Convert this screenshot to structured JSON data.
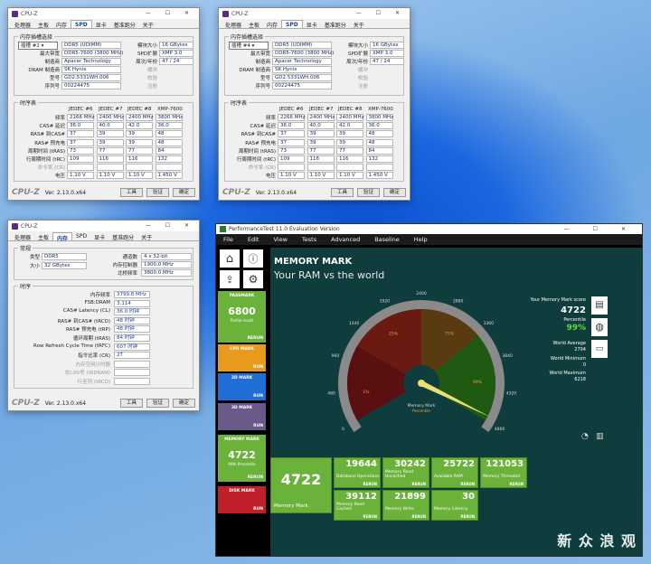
{
  "cpuz1": {
    "title": "CPU-Z",
    "tabs": [
      "处理器",
      "主板",
      "内存",
      "SPD",
      "显卡",
      "基准跑分",
      "关于"
    ],
    "group1": "内存插槽选择",
    "slot": "插槽 #2",
    "type": "DDR5 (UDIMM)",
    "size_label": "模块大小",
    "size": "16 GBytes",
    "maxbw_label": "最大带宽",
    "maxbw": "DDR5-7600 (3800 MHz)",
    "spd_label": "SPD扩展",
    "spd": "XMP 3.0",
    "maker_label": "制造商",
    "maker": "Apacer Technology",
    "week_label": "周次/年份",
    "week": "47 / 24",
    "dram_label": "DRAM 制造商",
    "dram": "SK Hynix",
    "reg_label": "缓冲",
    "part_label": "型号",
    "part": "GD2.5331WH.006",
    "ecc_label": "校验",
    "serial_label": "序列号",
    "serial": "00224475",
    "reg2_label": "注册",
    "timing_group": "时序表",
    "cols": [
      "JEDEC #6",
      "JEDEC #7",
      "JEDEC #8",
      "XMP-7600"
    ],
    "rows": [
      {
        "l": "频率",
        "v": [
          "2266 MHz",
          "2400 MHz",
          "2400 MHz",
          "3800 MHz"
        ]
      },
      {
        "l": "CAS# 延迟",
        "v": [
          "36.0",
          "40.0",
          "42.0",
          "36.0"
        ]
      },
      {
        "l": "RAS# 到CAS#",
        "v": [
          "37",
          "39",
          "39",
          "48"
        ]
      },
      {
        "l": "RAS# 预充电",
        "v": [
          "37",
          "39",
          "39",
          "48"
        ]
      },
      {
        "l": "周期时间 (tRAS)",
        "v": [
          "73",
          "77",
          "77",
          "84"
        ]
      },
      {
        "l": "行周期时间 (tRC)",
        "v": [
          "109",
          "116",
          "116",
          "132"
        ]
      },
      {
        "l": "命令率 (CR)",
        "v": [
          "",
          "",
          "",
          ""
        ]
      },
      {
        "l": "电压",
        "v": [
          "1.10 V",
          "1.10 V",
          "1.10 V",
          "1.450 V"
        ]
      }
    ],
    "ver": "Ver. 2.13.0.x64",
    "tools": "工具",
    "validate": "验证",
    "ok": "确定"
  },
  "cpuz2": {
    "slot": "插槽 #4"
  },
  "cpuz3": {
    "title": "CPU-Z",
    "tabs": [
      "处理器",
      "主板",
      "内存",
      "SPD",
      "显卡",
      "基准跑分",
      "关于"
    ],
    "g1": "常规",
    "type_l": "类型",
    "type": "DDR5",
    "size_l": "大小",
    "size": "32 GBytes",
    "ch_l": "通道数",
    "ch": "4 x 32-bit",
    "ctrl_l": "内存控制器",
    "ctrl": "1900.0 MHz",
    "nb_l": "北桥频率",
    "nb": "3800.0 MHz",
    "g2": "时序",
    "rows": [
      {
        "l": "内存频率",
        "v": "3799.8 MHz"
      },
      {
        "l": "FSB:DRAM",
        "v": "3:114"
      },
      {
        "l": "CAS# Latency (CL)",
        "v": "36.0 时钟"
      },
      {
        "l": "RAS# 到CAS# (tRCD)",
        "v": "48 时钟"
      },
      {
        "l": "RAS# 预充电 (tRP)",
        "v": "48 时钟"
      },
      {
        "l": "循环周期 (tRAS)",
        "v": "84 时钟"
      },
      {
        "l": "Row Refresh Cycle Time (tRFC)",
        "v": "607 时钟"
      },
      {
        "l": "指令比率 (CR)",
        "v": "2T"
      },
      {
        "l": "内存空闲计时器",
        "v": ""
      },
      {
        "l": "总CAS号 (tRDRAM)",
        "v": ""
      },
      {
        "l": "行至列 (tRCD)",
        "v": ""
      }
    ]
  },
  "pt": {
    "title": "PerformanceTest 11.0 Evaluation Version",
    "menu": [
      "File",
      "Edit",
      "View",
      "Tests",
      "Advanced",
      "Baseline",
      "Help"
    ],
    "heading": "MEMORY MARK",
    "subheading": "Your RAM vs the world",
    "score_label": "Your Memory Mark score",
    "score": "4722",
    "pct_label": "Percentile",
    "pct": "99%",
    "avg_label": "World Average",
    "avg": "2704",
    "min_label": "World Minimum",
    "min": "0",
    "max_label": "World Maximum",
    "max": "6218",
    "gauge_ticks": [
      "0",
      "480",
      "960",
      "1440",
      "1920",
      "2400",
      "2880",
      "3360",
      "3840",
      "4320",
      "4800"
    ],
    "gauge_pcts": [
      "1%",
      "25%",
      "75%",
      "99%"
    ],
    "gauge_label": "Memory Mark",
    "gauge_sub": "Percentile",
    "side": [
      {
        "name": "PASSMARK",
        "score": "6800",
        "sub": "Partial result",
        "run": "RERUN",
        "color": "#6ab23a"
      },
      {
        "name": "CPU MARK",
        "score": "",
        "sub": "",
        "run": "RUN",
        "color": "#e89a1c"
      },
      {
        "name": "2D MARK",
        "score": "",
        "sub": "",
        "run": "RUN",
        "color": "#1f6fd6"
      },
      {
        "name": "3D MARK",
        "score": "",
        "sub": "",
        "run": "RUN",
        "color": "#6a5a8a"
      },
      {
        "name": "MEMORY MARK",
        "score": "4722",
        "sub": "99th Percentile",
        "run": "RERUN",
        "color": "#6ab23a"
      },
      {
        "name": "DISK MARK",
        "score": "",
        "sub": "",
        "run": "RUN",
        "color": "#c0202a"
      }
    ],
    "big": {
      "score": "4722",
      "label": "Memory Mark"
    },
    "sub": [
      {
        "n": "19644",
        "l": "Database Operations",
        "r": "RERUN"
      },
      {
        "n": "30242",
        "l": "Memory Read Uncached",
        "r": "RERUN"
      },
      {
        "n": "25722",
        "l": "Available RAM",
        "r": "RERUN"
      },
      {
        "n": "121053",
        "l": "Memory Threaded",
        "r": "RERUN"
      },
      {
        "n": "39112",
        "l": "Memory Read Cached",
        "r": "RERUN"
      },
      {
        "n": "21899",
        "l": "Memory Write",
        "r": "RERUN"
      },
      {
        "n": "30",
        "l": "Memory Latency",
        "r": "RERUN"
      }
    ],
    "needle_value": 4722,
    "gauge_max": 4800
  },
  "watermark": "新 众 浪 观"
}
